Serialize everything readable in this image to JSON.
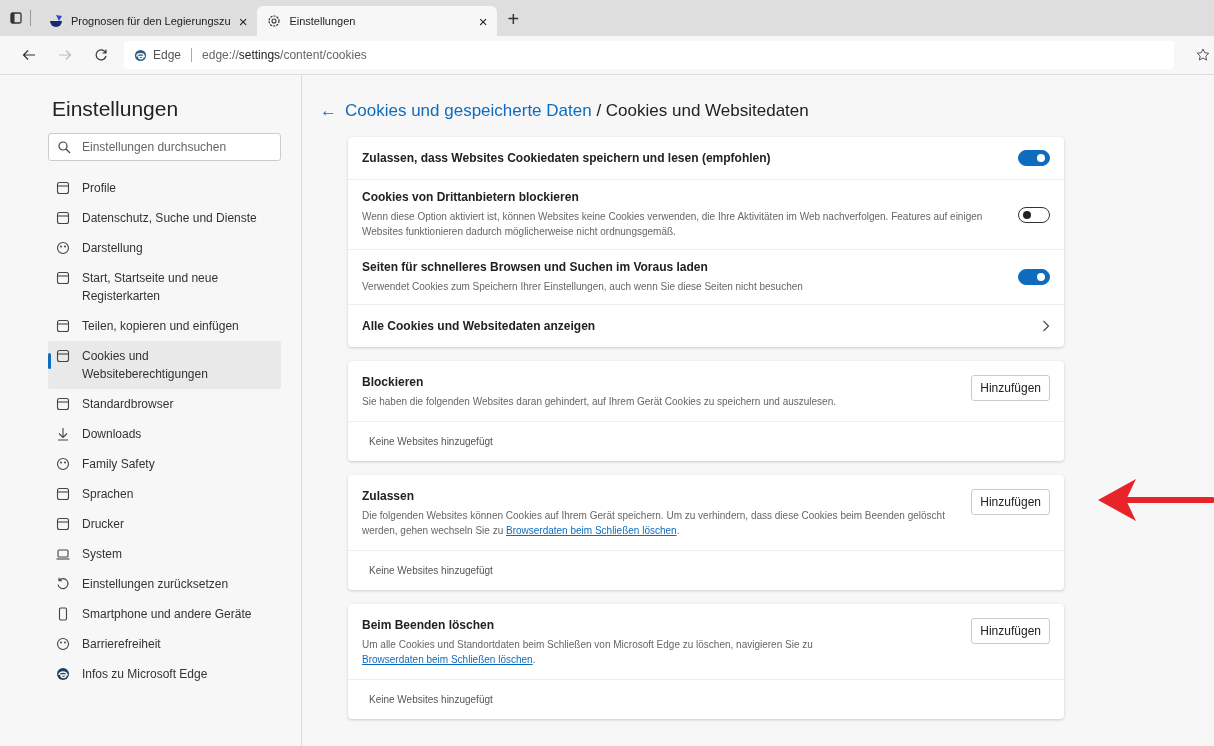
{
  "tabs": [
    {
      "title": "Prognosen für den Legierungszu",
      "selected": false,
      "close": "×"
    },
    {
      "title": "Einstellungen",
      "selected": true,
      "close": "×"
    }
  ],
  "new_tab": "+",
  "address_bar": {
    "site": "Edge",
    "url_prefix": "edge://",
    "url_bold": "settings",
    "url_rest": "/content/cookies"
  },
  "sidebar": {
    "title": "Einstellungen",
    "search": {
      "placeholder": "Einstellungen durchsuchen"
    },
    "items": [
      {
        "label": "Profile",
        "selected": false
      },
      {
        "label": "Datenschutz, Suche und Dienste",
        "selected": false
      },
      {
        "label": "Darstellung",
        "selected": false
      },
      {
        "label": "Start, Startseite und neue Registerkarten",
        "selected": false
      },
      {
        "label": "Teilen, kopieren und einfügen",
        "selected": false
      },
      {
        "label": "Cookies und Websiteberechtigungen",
        "selected": true
      },
      {
        "label": "Standardbrowser",
        "selected": false
      },
      {
        "label": "Downloads",
        "selected": false
      },
      {
        "label": "Family Safety",
        "selected": false
      },
      {
        "label": "Sprachen",
        "selected": false
      },
      {
        "label": "Drucker",
        "selected": false
      },
      {
        "label": "System",
        "selected": false
      },
      {
        "label": "Einstellungen zurücksetzen",
        "selected": false
      },
      {
        "label": "Smartphone und andere Geräte",
        "selected": false
      },
      {
        "label": "Barrierefreiheit",
        "selected": false
      },
      {
        "label": "Infos zu Microsoft Edge",
        "selected": false
      }
    ]
  },
  "breadcrumb": {
    "back": "←",
    "parent": "Cookies und gespeicherte Daten",
    "separator": " / ",
    "current": "Cookies und Websitedaten"
  },
  "settings": [
    {
      "kind": "toggle",
      "title": "Zulassen, dass Websites Cookiedaten speichern und lesen (empfohlen)",
      "on": true
    },
    {
      "kind": "toggle",
      "title": "Cookies von Drittanbietern blockieren",
      "description": "Wenn diese Option aktiviert ist, können Websites keine Cookies verwenden, die Ihre Aktivitäten im Web nachverfolgen. Features auf einigen Websites funktionieren dadurch möglicherweise nicht ordnungsgemäß.",
      "on": false
    },
    {
      "kind": "toggle",
      "title": "Seiten für schnelleres Browsen und Suchen im Voraus laden",
      "description": "Verwendet Cookies zum Speichern Ihrer Einstellungen, auch wenn Sie diese Seiten nicht besuchen",
      "on": true
    },
    {
      "kind": "link",
      "title": "Alle Cookies und Websitedaten anzeigen"
    }
  ],
  "sections": [
    {
      "title": "Blockieren",
      "text_before": "Sie haben die folgenden Websites daran gehindert, auf Ihrem Gerät Cookies zu speichern und auszulesen.",
      "button": "Hinzufügen",
      "empty": "Keine Websites hinzugefügt"
    },
    {
      "title": "Zulassen",
      "text_before": "Die folgenden Websites können Cookies auf Ihrem Gerät speichern. Um zu verhindern, dass diese Cookies beim Beenden gelöscht werden, gehen wechseln Sie zu ",
      "link": "Browserdaten beim Schließen löschen",
      "text_after": ".",
      "button": "Hinzufügen",
      "empty": "Keine Websites hinzugefügt",
      "annotated": true
    },
    {
      "title": "Beim Beenden löschen",
      "text_before": "Um alle Cookies und Standortdaten beim Schließen von Microsoft Edge zu löschen, navigieren Sie zu ",
      "link": "Browserdaten beim Schließen löschen",
      "text_after": ".",
      "button": "Hinzufügen",
      "empty": "Keine Websites hinzugefügt"
    }
  ]
}
